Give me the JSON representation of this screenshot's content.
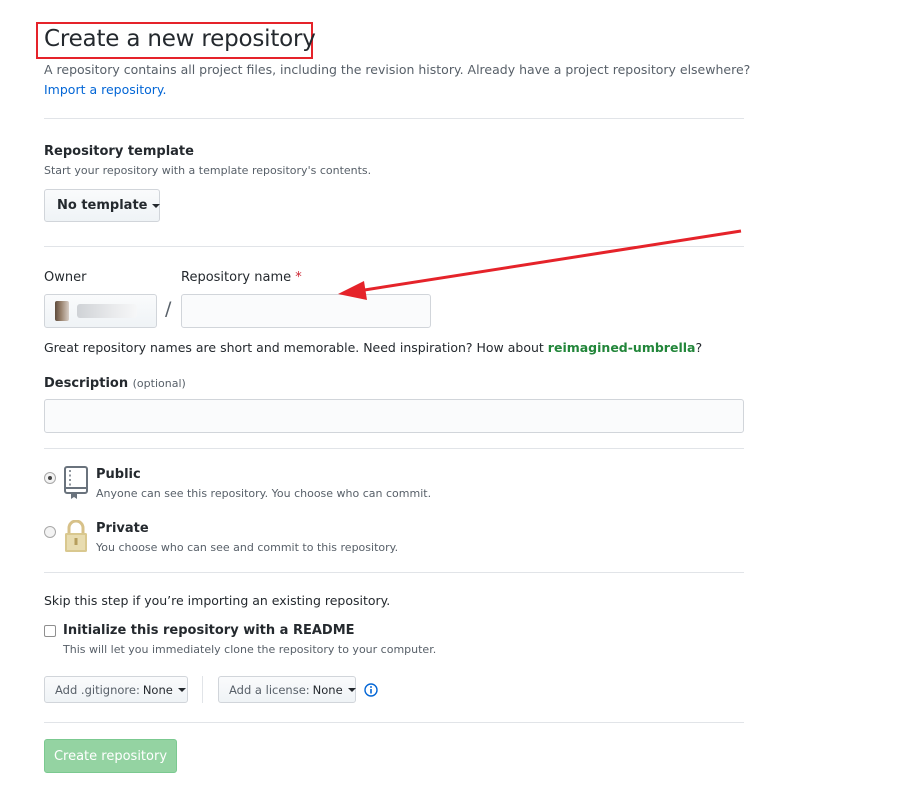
{
  "header": {
    "title": "Create a new repository",
    "subtitle": "A repository contains all project files, including the revision history. Already have a project repository elsewhere?",
    "import_link": "Import a repository."
  },
  "template": {
    "label": "Repository template",
    "note": "Start your repository with a template repository's contents.",
    "button_label": "No template"
  },
  "owner": {
    "label": "Owner",
    "value": "",
    "separator": "/"
  },
  "repo_name": {
    "label": "Repository name",
    "required_marker": "*",
    "value": "",
    "placeholder": ""
  },
  "suggestion": {
    "prefix": "Great repository names are short and memorable. Need inspiration? How about ",
    "name": "reimagined-umbrella",
    "suffix": "?"
  },
  "description": {
    "label": "Description",
    "optional": "(optional)",
    "value": "",
    "placeholder": ""
  },
  "visibility": {
    "options": [
      {
        "title": "Public",
        "desc": "Anyone can see this repository. You choose who can commit.",
        "icon": "repo-book-icon",
        "selected": true
      },
      {
        "title": "Private",
        "desc": "You choose who can see and commit to this repository.",
        "icon": "lock-icon",
        "selected": false
      }
    ]
  },
  "init": {
    "skip_text": "Skip this step if you’re importing an existing repository.",
    "readme_label": "Initialize this repository with a README",
    "readme_note": "This will let you immediately clone the repository to your computer.",
    "readme_checked": false,
    "gitignore_prefix": "Add .gitignore:",
    "gitignore_value": "None",
    "license_prefix": "Add a license:",
    "license_value": "None"
  },
  "submit": {
    "label": "Create repository",
    "enabled": false
  },
  "colors": {
    "link": "#0366d6",
    "suggestion": "#22863a",
    "annotation_red": "#e5232a",
    "create_button_disabled": "#94d3a2"
  }
}
